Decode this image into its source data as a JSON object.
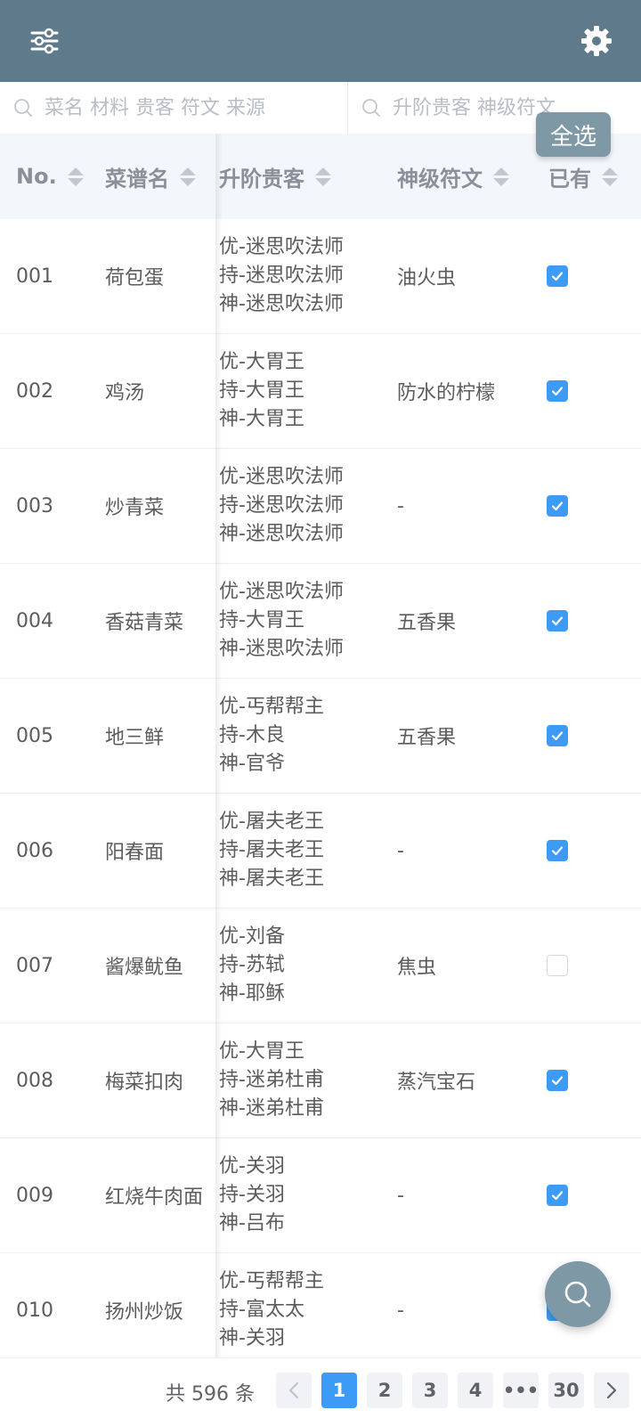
{
  "toolbar": {
    "filter_icon": "sliders-icon",
    "settings_icon": "gear-icon"
  },
  "search": {
    "dish_placeholder": "菜名 材料 贵客 符文 来源",
    "guest_placeholder": "升阶贵客 神级符文"
  },
  "select_all_label": "全选",
  "columns": {
    "no": "No.",
    "name": "菜谱名",
    "guests": "升阶贵客",
    "rune": "神级符文",
    "own": "已有"
  },
  "rows": [
    {
      "no": "001",
      "name": "荷包蛋",
      "guest1": "优-迷思吹法师",
      "guest2": "持-迷思吹法师",
      "guest3": "神-迷思吹法师",
      "rune": "油火虫",
      "owned": true
    },
    {
      "no": "002",
      "name": "鸡汤",
      "guest1": "优-大胃王",
      "guest2": "持-大胃王",
      "guest3": "神-大胃王",
      "rune": "防水的柠檬",
      "owned": true
    },
    {
      "no": "003",
      "name": "炒青菜",
      "guest1": "优-迷思吹法师",
      "guest2": "持-迷思吹法师",
      "guest3": "神-迷思吹法师",
      "rune": "-",
      "owned": true
    },
    {
      "no": "004",
      "name": "香菇青菜",
      "guest1": "优-迷思吹法师",
      "guest2": "持-大胃王",
      "guest3": "神-迷思吹法师",
      "rune": "五香果",
      "owned": true
    },
    {
      "no": "005",
      "name": "地三鲜",
      "guest1": "优-丐帮帮主",
      "guest2": "持-木良",
      "guest3": "神-官爷",
      "rune": "五香果",
      "owned": true
    },
    {
      "no": "006",
      "name": "阳春面",
      "guest1": "优-屠夫老王",
      "guest2": "持-屠夫老王",
      "guest3": "神-屠夫老王",
      "rune": "-",
      "owned": true
    },
    {
      "no": "007",
      "name": "酱爆鱿鱼",
      "guest1": "优-刘备",
      "guest2": "持-苏轼",
      "guest3": "神-耶稣",
      "rune": "焦虫",
      "owned": false
    },
    {
      "no": "008",
      "name": "梅菜扣肉",
      "guest1": "优-大胃王",
      "guest2": "持-迷弟杜甫",
      "guest3": "神-迷弟杜甫",
      "rune": "蒸汽宝石",
      "owned": true
    },
    {
      "no": "009",
      "name": "红烧牛肉面",
      "guest1": "优-关羽",
      "guest2": "持-关羽",
      "guest3": "神-吕布",
      "rune": "-",
      "owned": true
    },
    {
      "no": "010",
      "name": "扬州炒饭",
      "guest1": "优-丐帮帮主",
      "guest2": "持-富太太",
      "guest3": "神-关羽",
      "rune": "-",
      "owned": true
    }
  ],
  "pagination": {
    "total_text": "共 596 条",
    "pages": [
      "1",
      "2",
      "3",
      "4",
      "•••",
      "30"
    ],
    "current": "1",
    "prev_icon": "chevron-left-icon",
    "next_icon": "chevron-right-icon"
  },
  "fab_icon": "search-icon",
  "colors": {
    "header_bg": "#5f7b8b",
    "accent": "#3e9bf5",
    "button_bg": "#7f98a6"
  }
}
